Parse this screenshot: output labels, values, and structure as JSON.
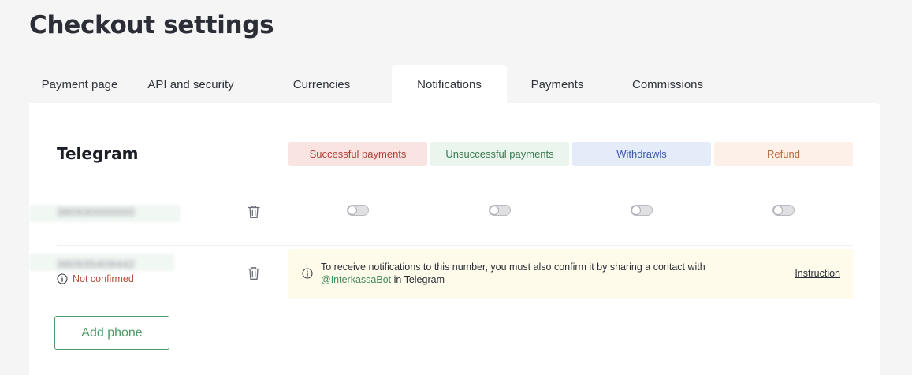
{
  "page": {
    "title": "Checkout settings"
  },
  "tabs": [
    {
      "label": "Payment page",
      "active": false
    },
    {
      "label": "API and security",
      "active": false
    },
    {
      "label": "Currencies",
      "active": false
    },
    {
      "label": "Notifications",
      "active": true
    },
    {
      "label": "Payments",
      "active": false
    },
    {
      "label": "Commissions",
      "active": false
    }
  ],
  "telegram": {
    "title": "Telegram",
    "columns": {
      "successful": "Successful payments",
      "unsuccessful": "Unsuccessful payments",
      "withdrawls": "Withdrawls",
      "refund": "Refund"
    },
    "phones": [
      {
        "number": "380930000000",
        "toggles": {
          "successful": false,
          "unsuccessful": false,
          "withdrawls": false,
          "refund": false
        }
      },
      {
        "number": "380935409442",
        "status": "Not confirmed"
      }
    ],
    "notice": {
      "text": "To receive notifications to this number, you must also confirm it by sharing a contact with",
      "bot": "@InterkassaBot",
      "suffix": " in Telegram",
      "link": "Instruction"
    },
    "add_button": "Add phone"
  },
  "colors": {
    "accent_green": "#4f9a66",
    "successful_bg": "#f9e4e2",
    "unsuccessful_bg": "#eaf5ee",
    "withdrawls_bg": "#e4ecf9",
    "refund_bg": "#fdf0e8",
    "notice_bg": "#fffbeb"
  },
  "icons": {
    "delete": "trash-icon",
    "info": "info-icon"
  }
}
